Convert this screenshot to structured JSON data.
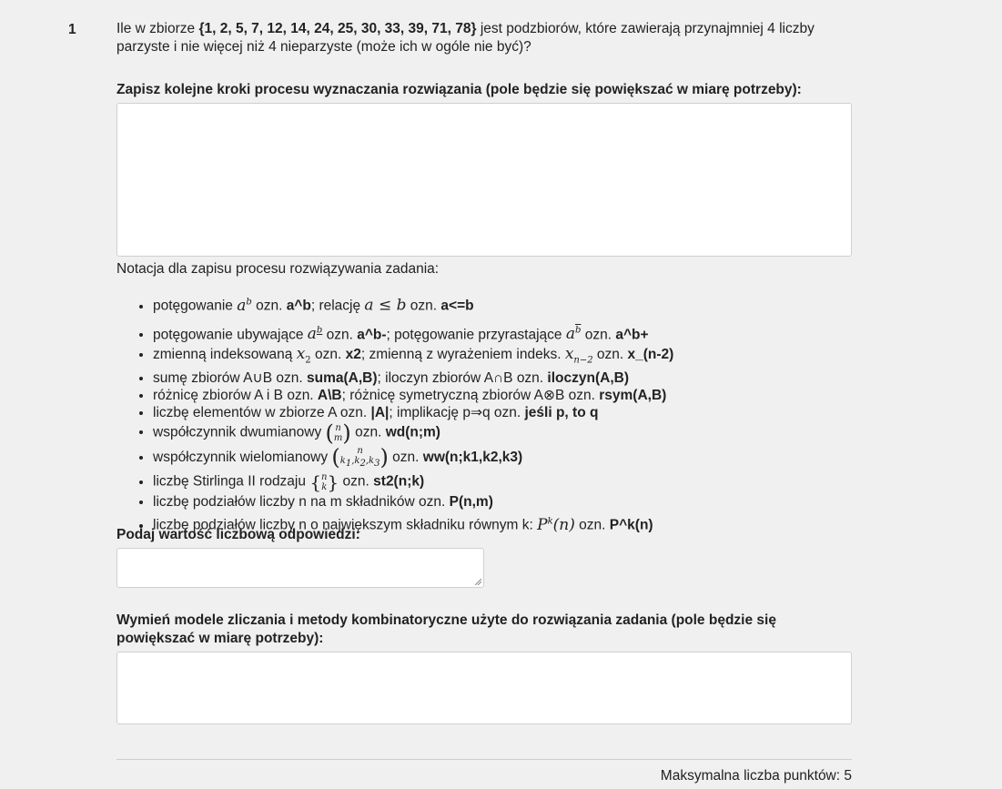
{
  "question": {
    "number": "1",
    "text_pre": "Ile w zbiorze ",
    "set": "{1, 2, 5, 7, 12, 14, 24, 25, 30, 33, 39, 71, 78}",
    "text_post": " jest podzbiorów, które zawierają przynajmniej 4 liczby parzyste i nie więcej niż 4 nieparzyste (może ich w ogóle nie być)?"
  },
  "steps": {
    "label": "Zapisz kolejne kroki procesu wyznaczania rozwiązania (pole będzie się powiększać w miarę potrzeby):",
    "value": ""
  },
  "notation": {
    "title": "Notacja dla zapisu procesu rozwiązywania zadania:",
    "items": [
      {
        "t1": "potęgowanie ",
        "t2": " ozn. ",
        "b1": "a^b",
        "t3": ";   relację ",
        "t4": " ozn. ",
        "b2": "a<=b"
      },
      {
        "t1": "potęgowanie ubywające ",
        "t2": " ozn. ",
        "b1": "a^b-",
        "t3": ";   potęgowanie przyrastające ",
        "t4": " ozn. ",
        "b2": "a^b+"
      },
      {
        "t1": "zmienną indeksowaną ",
        "t2": " ozn. ",
        "b1": "x2",
        "t3": ";  zmienną z wyrażeniem indeks. ",
        "t4": " ozn. ",
        "b2": "x_(n-2)"
      },
      {
        "t1": "sumę zbiorów A∪B ozn. ",
        "b1": "suma(A,B)",
        "t3": ";   iloczyn zbiorów A∩B ozn. ",
        "b2": "iloczyn(A,B)"
      },
      {
        "t1": "różnicę zbiorów A i B ozn. ",
        "b1": "A\\B",
        "t3": ";   różnicę symetryczną zbiorów A⊗B ozn. ",
        "b2": "rsym(A,B)"
      },
      {
        "t1": "liczbę elementów w zbiorze A ozn. ",
        "b1": "|A|",
        "t3": ";   implikację p⇒q ozn. ",
        "b2": "jeśli p, to q"
      },
      {
        "t1": "współczynnik dwumianowy ",
        "t2": " ozn. ",
        "b1": "wd(n;m)"
      },
      {
        "t1": "współczynnik wielomianowy ",
        "t2": " ozn. ",
        "b1": "ww(n;k1,k2,k3)"
      },
      {
        "t1": "liczbę Stirlinga II rodzaju ",
        "t2": " ozn. ",
        "b1": "st2(n;k)"
      },
      {
        "t1": "liczbę podziałów liczby n na m składników ozn. ",
        "b1": "P(n,m)"
      },
      {
        "t1": "liczbę podziałów liczby n o największym składniku równym k: ",
        "t2": " ozn. ",
        "b1": "P^k(n)"
      }
    ]
  },
  "answer": {
    "label": "Podaj wartość liczbową odpowiedzi:",
    "value": ""
  },
  "models": {
    "label": "Wymień modele zliczania i metody kombinatoryczne użyte do rozwiązania zadania (pole będzie się powiększać w miarę potrzeby):",
    "value": ""
  },
  "footer": {
    "points": "Maksymalna liczba punktów: 5"
  }
}
